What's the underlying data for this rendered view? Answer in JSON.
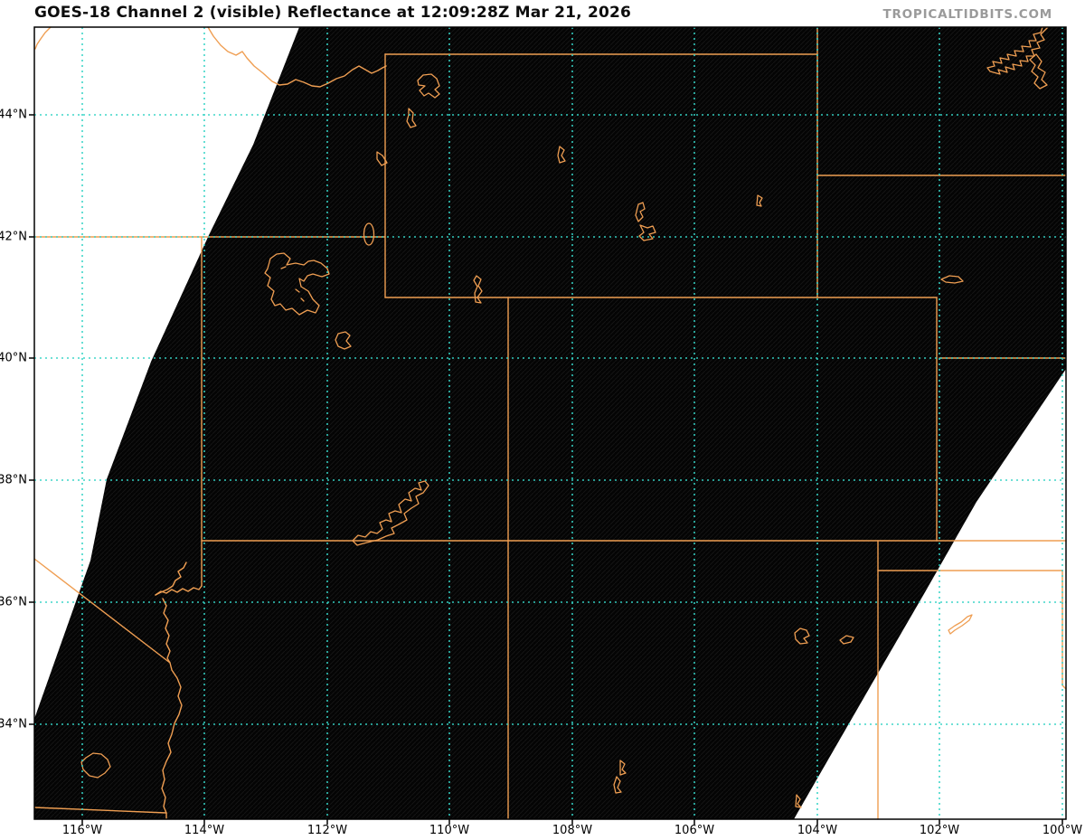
{
  "header": {
    "title": "GOES-18 Channel 2 (visible) Reflectance at 12:09:28Z Mar 21, 2026",
    "satellite": "GOES-18",
    "channel": "Channel 2 (visible)",
    "product": "Reflectance",
    "valid_time": "12:09:28Z Mar 21, 2026",
    "watermark": "TROPICALTIDBITS.COM"
  },
  "map": {
    "projection": "lat-lon grid, approx 117W-100W / 32.4N-45.4N",
    "axes": {
      "x": {
        "labels": [
          {
            "text": "116°W",
            "lon": -116
          },
          {
            "text": "114°W",
            "lon": -114
          },
          {
            "text": "112°W",
            "lon": -112
          },
          {
            "text": "110°W",
            "lon": -110
          },
          {
            "text": "108°W",
            "lon": -108
          },
          {
            "text": "106°W",
            "lon": -106
          },
          {
            "text": "104°W",
            "lon": -104
          },
          {
            "text": "102°W",
            "lon": -102
          },
          {
            "text": "100°W",
            "lon": -100
          }
        ]
      },
      "y": {
        "labels": [
          {
            "text": "44°N",
            "lat": 44
          },
          {
            "text": "42°N",
            "lat": 42
          },
          {
            "text": "40°N",
            "lat": 40
          },
          {
            "text": "38°N",
            "lat": 38
          },
          {
            "text": "36°N",
            "lat": 36
          },
          {
            "text": "34°N",
            "lat": 34
          }
        ]
      }
    },
    "colors": {
      "background_no_data": "#ffffff",
      "night_swath": "#040404",
      "swath_scanline_stripe": "#141414",
      "state_borders": "#ef9e52",
      "graticule": "#35d3c6",
      "axis_frame": "#000000",
      "title_text": "#0d0d0d",
      "watermark_text": "#9a9a9a"
    },
    "layers": [
      "night-dark satellite swath (parallelogram) with diagonal scan-line texture",
      "white no-data wedges upper-left and lower-right",
      "orange state borders: WY box, MT-SD 104W, SD-NE 43N, NE-KS 40N, CO-NE-KS 102W, 37N line, UT-CO-AZ-NM 109W, NV-UT 114W, 42N line, NM-TX 103W, TX-OK 36.5N and 100W, ID-MT wiggle, OR-ID corner, CA-NV diagonal, Colorado River, Mexico border",
      "orange lake outlines: Yellowstone, Jackson, Palisades, Boysen, Bear, Pathfinder, Glendo, Great Salt Lake, Utah Lake, Flaming Gorge, Lake Powell, Lake McConaughy, Lake Oahe, Conchas, Ute, Elephant Butte, Salton Sea, Lake Meredith",
      "dotted cyan graticule every 2 degrees",
      "black axis frame with outward ticks"
    ]
  }
}
